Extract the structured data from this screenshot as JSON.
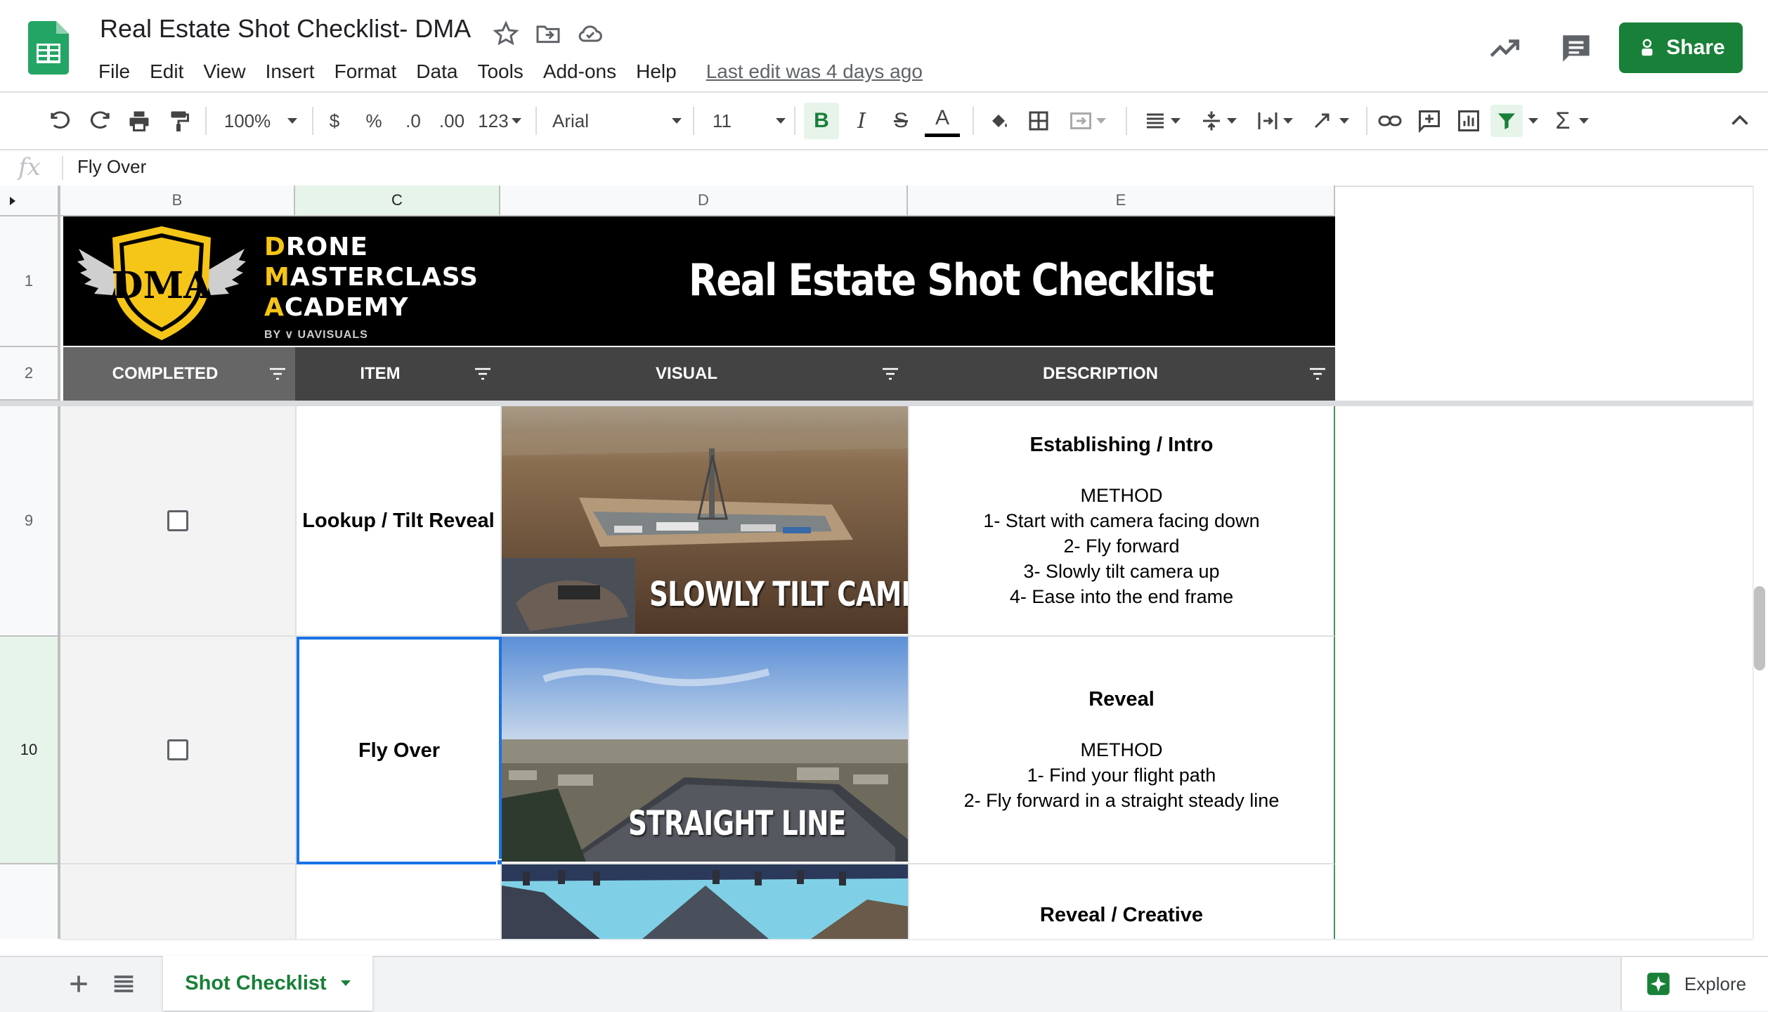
{
  "app": {
    "title": "Real Estate Shot Checklist- DMA",
    "last_edit": "Last edit was 4 days ago",
    "share_label": "Share",
    "menu": [
      "File",
      "Edit",
      "View",
      "Insert",
      "Format",
      "Data",
      "Tools",
      "Add-ons",
      "Help"
    ]
  },
  "toolbar": {
    "zoom": "100%",
    "currency": "$",
    "percent": "%",
    "decrease_decimal": ".0",
    "increase_decimal": ".00",
    "more_formats": "123",
    "font": "Arial",
    "font_size": "11",
    "bold": "B",
    "italic": "I",
    "strikethrough": "S",
    "text_color": "A",
    "functions": "Σ"
  },
  "formula_bar": {
    "fx": "fx",
    "value": "Fly Over"
  },
  "columns": [
    "B",
    "C",
    "D",
    "E"
  ],
  "rows": [
    "1",
    "2",
    "9",
    "10"
  ],
  "banner": {
    "logo_letters": "DMA",
    "word_line1_cap": "D",
    "word_line1": "RONE",
    "word_line2_cap": "M",
    "word_line2": "ASTERCLASS",
    "word_line3_cap": "A",
    "word_line3": "CADEMY",
    "by": "BY ∨ UAVISUALS",
    "title": "Real Estate Shot Checklist"
  },
  "headers": [
    "COMPLETED",
    "ITEM",
    "VISUAL",
    "DESCRIPTION"
  ],
  "items": [
    {
      "row": "9",
      "completed": false,
      "item": "Lookup / Tilt Reveal",
      "visual_caption": "SLOWLY TILT CAMERA UP",
      "desc_title": "Establishing / Intro",
      "desc_lines": [
        "METHOD",
        "1- Start with camera facing down",
        "2- Fly forward",
        "3- Slowly tilt camera up",
        "4- Ease into the end frame"
      ]
    },
    {
      "row": "10",
      "completed": false,
      "item": "Fly Over",
      "visual_caption": "STRAIGHT LINE",
      "desc_title": "Reveal",
      "desc_lines": [
        "METHOD",
        "1- Find your flight path",
        "2- Fly forward in a straight steady line"
      ]
    },
    {
      "row": "",
      "completed": false,
      "item": "",
      "visual_caption": "",
      "desc_title": "Reveal / Creative",
      "desc_lines": []
    }
  ],
  "sheet_tab": "Shot Checklist",
  "explore_label": "Explore",
  "colors": {
    "brand_green": "#188038",
    "header_dark": "#434343",
    "header_grey": "#666666",
    "banner_bg": "#000000",
    "dma_gold": "#f5c518"
  }
}
